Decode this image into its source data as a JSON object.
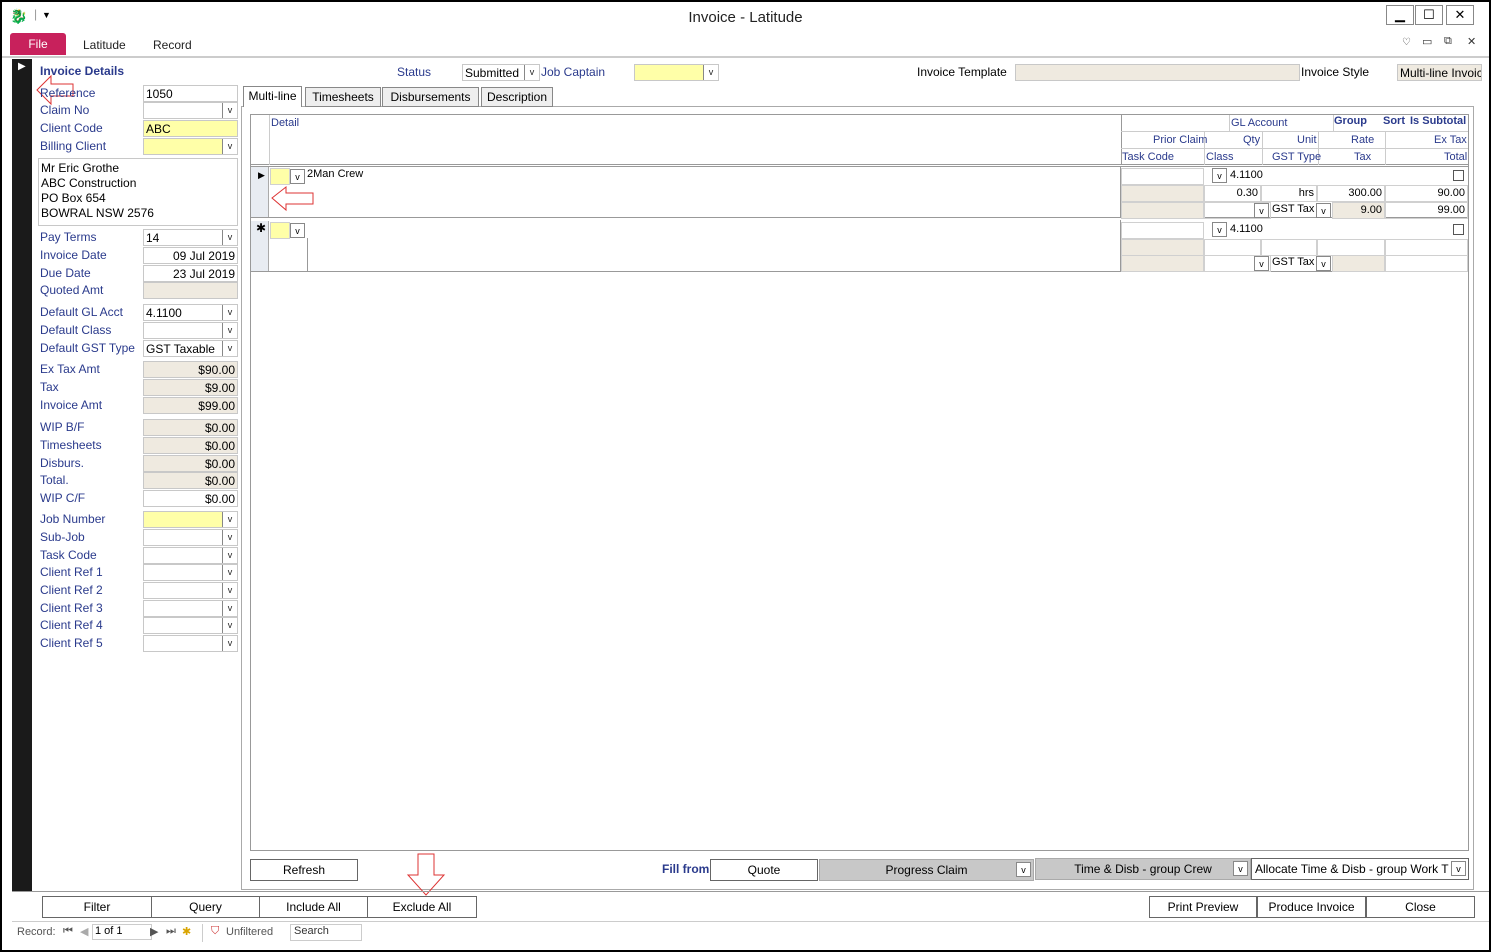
{
  "window": {
    "title": "Invoice - Latitude",
    "minimize": "▁",
    "maximize": "☐",
    "close": "✕"
  },
  "ribbon": {
    "file": "File",
    "tabs": [
      "Latitude",
      "Record"
    ]
  },
  "header": {
    "section_title": "Invoice Details",
    "status_label": "Status",
    "status_value": "Submitted",
    "job_captain_label": "Job Captain",
    "job_captain_value": "",
    "invoice_template_label": "Invoice Template",
    "invoice_template_value": "",
    "invoice_style_label": "Invoice Style",
    "invoice_style_value": "Multi-line Invoic"
  },
  "left": {
    "reference_label": "Reference",
    "reference_value": "1050",
    "claim_no_label": "Claim No",
    "claim_no_value": "",
    "client_code_label": "Client Code",
    "client_code_value": "ABC",
    "billing_client_label": "Billing Client",
    "billing_client_value": "",
    "address": [
      "Mr Eric Grothe",
      "ABC Construction",
      "PO Box 654",
      "BOWRAL  NSW  2576"
    ],
    "pay_terms_label": "Pay Terms",
    "pay_terms_value": "14",
    "invoice_date_label": "Invoice Date",
    "invoice_date_value": "09 Jul 2019",
    "due_date_label": "Due Date",
    "due_date_value": "23 Jul 2019",
    "quoted_amt_label": "Quoted Amt",
    "quoted_amt_value": "",
    "default_gl_label": "Default GL Acct",
    "default_gl_value": "4.1100",
    "default_class_label": "Default Class",
    "default_class_value": "",
    "default_gst_label": "Default GST Type",
    "default_gst_value": "GST Taxable",
    "ex_tax_label": "Ex Tax Amt",
    "ex_tax_value": "$90.00",
    "tax_label": "Tax",
    "tax_value": "$9.00",
    "invoice_amt_label": "Invoice Amt",
    "invoice_amt_value": "$99.00",
    "wip_bf_label": "WIP B/F",
    "wip_bf_value": "$0.00",
    "timesheets_label": "Timesheets",
    "timesheets_value": "$0.00",
    "disburs_label": "Disburs.",
    "disburs_value": "$0.00",
    "total_label": "Total.",
    "total_value": "$0.00",
    "wip_cf_label": "WIP C/F",
    "wip_cf_value": "$0.00",
    "job_number_label": "Job Number",
    "sub_job_label": "Sub-Job",
    "task_code_label": "Task Code",
    "client_ref1_label": "Client Ref 1",
    "client_ref2_label": "Client Ref 2",
    "client_ref3_label": "Client Ref 3",
    "client_ref4_label": "Client Ref 4",
    "client_ref5_label": "Client Ref 5"
  },
  "tabs": [
    "Multi-line",
    "Timesheets",
    "Disbursements",
    "Description"
  ],
  "grid": {
    "col_detail": "Detail",
    "col_gl_account": "GL Account",
    "col_group": "Group",
    "col_sort": "Sort",
    "col_is_subtotal": "Is Subtotal",
    "col_prior_claim": "Prior Claim",
    "col_qty": "Qty",
    "col_unit": "Unit",
    "col_rate": "Rate",
    "col_ex_tax": "Ex Tax",
    "col_task_code": "Task Code",
    "col_class": "Class",
    "col_gst_type": "GST Type",
    "col_tax": "Tax",
    "col_total": "Total",
    "row1": {
      "detail": "2Man Crew",
      "gl": "4.1100",
      "qty": "0.30",
      "unit": "hrs",
      "rate": "300.00",
      "ex_tax": "90.00",
      "gst": "GST Tax",
      "tax": "9.00",
      "total": "99.00"
    },
    "row2": {
      "gl": "4.1100",
      "gst": "GST Tax"
    },
    "new_marker": "✱"
  },
  "bottom": {
    "refresh": "Refresh",
    "fill_from_label": "Fill from",
    "quote": "Quote",
    "progress_claim": "Progress Claim",
    "time_disb_crew": "Time & Disb - group Crew",
    "allocate": "Allocate Time & Disb - group Work T"
  },
  "footer_buttons": {
    "filter": "Filter",
    "query": "Query",
    "include_all": "Include All",
    "exclude_all": "Exclude All",
    "print_preview": "Print Preview",
    "produce_invoice": "Produce Invoice",
    "close": "Close"
  },
  "statusbar": {
    "record_label": "Record:",
    "record_value": "1 of 1",
    "filter_state": "Unfiltered",
    "search": "Search"
  }
}
